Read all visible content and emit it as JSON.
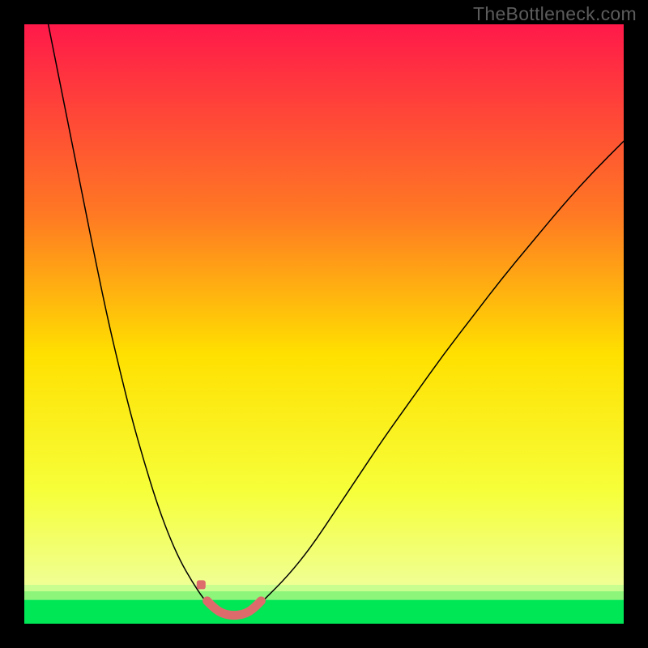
{
  "watermark": "TheBottleneck.com",
  "chart_data": {
    "type": "line",
    "title": "",
    "xlabel": "",
    "ylabel": "",
    "xlim": [
      0,
      100
    ],
    "ylim": [
      0,
      100
    ],
    "grid": false,
    "legend": false,
    "background_gradient": {
      "top_color": "#ff194a",
      "mid_color": "#fef200",
      "bottom_band_color": "#00e756",
      "bottom_band_start": 96
    },
    "series": [
      {
        "name": "left-curve",
        "color": "#000000",
        "width": 1.5,
        "x": [
          4,
          6,
          8,
          10,
          12,
          14,
          16,
          18,
          20,
          22,
          24,
          26,
          28,
          30,
          31.5
        ],
        "y": [
          100,
          90,
          80,
          70,
          60,
          50.5,
          42,
          34,
          27,
          20.5,
          15,
          10.5,
          7,
          4,
          2.5
        ]
      },
      {
        "name": "right-curve",
        "color": "#000000",
        "width": 1.5,
        "x": [
          38.5,
          40,
          44,
          48,
          52,
          56,
          60,
          65,
          70,
          75,
          80,
          85,
          90,
          95,
          100
        ],
        "y": [
          2.5,
          4,
          8,
          13,
          19,
          25,
          31,
          38,
          45,
          51.5,
          58,
          64,
          70,
          75.5,
          80.5
        ]
      },
      {
        "name": "marker-band",
        "color": "#dd6b6b",
        "width": 11,
        "x": [
          30.5,
          31.5,
          32.5,
          33.5,
          34.5,
          35.5,
          36.5,
          37.5,
          38.5,
          39.5
        ],
        "y": [
          3.8,
          2.8,
          2.0,
          1.6,
          1.4,
          1.4,
          1.6,
          2.0,
          2.8,
          3.8
        ]
      },
      {
        "name": "marker-dot",
        "color": "#dd6b6b",
        "type": "scatter",
        "size": 11,
        "x": [
          29.5
        ],
        "y": [
          6.5
        ]
      }
    ]
  }
}
